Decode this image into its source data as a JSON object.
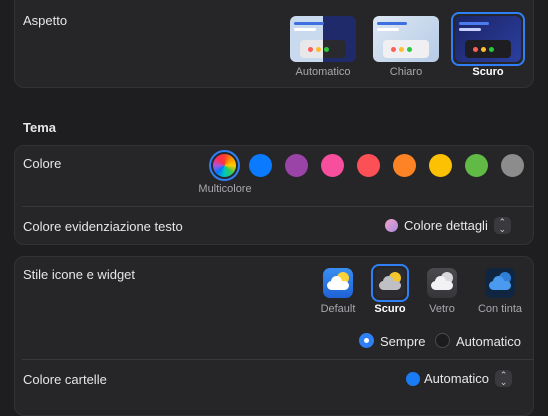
{
  "appearance": {
    "label": "Aspetto",
    "options": [
      {
        "label": "Automatico",
        "selected": false
      },
      {
        "label": "Chiaro",
        "selected": false
      },
      {
        "label": "Scuro",
        "selected": true
      }
    ]
  },
  "theme": {
    "section_title": "Tema",
    "accent": {
      "label": "Colore",
      "selected_caption": "Multicolore",
      "swatches": [
        "multicolor",
        "#0a7aff",
        "#9b44a8",
        "#f74f9e",
        "#fc5057",
        "#fd8325",
        "#fdc103",
        "#62ba46",
        "#8c8c8c"
      ]
    },
    "highlight": {
      "label": "Colore evidenziazione testo",
      "value": "Colore dettagli"
    }
  },
  "widgets": {
    "label": "Stile icone e widget",
    "options": [
      {
        "label": "Default",
        "selected": false
      },
      {
        "label": "Scuro",
        "selected": true
      },
      {
        "label": "Vetro",
        "selected": false
      },
      {
        "label": "Con tinta",
        "selected": false
      }
    ],
    "mode_options": [
      {
        "label": "Sempre",
        "selected": true
      },
      {
        "label": "Automatico",
        "selected": false
      }
    ]
  },
  "folders": {
    "label": "Colore cartelle",
    "value": "Automatico"
  },
  "colors": {
    "accent_blue": "#2f7ff7",
    "panel": "#262628",
    "background": "#1e1e20"
  }
}
